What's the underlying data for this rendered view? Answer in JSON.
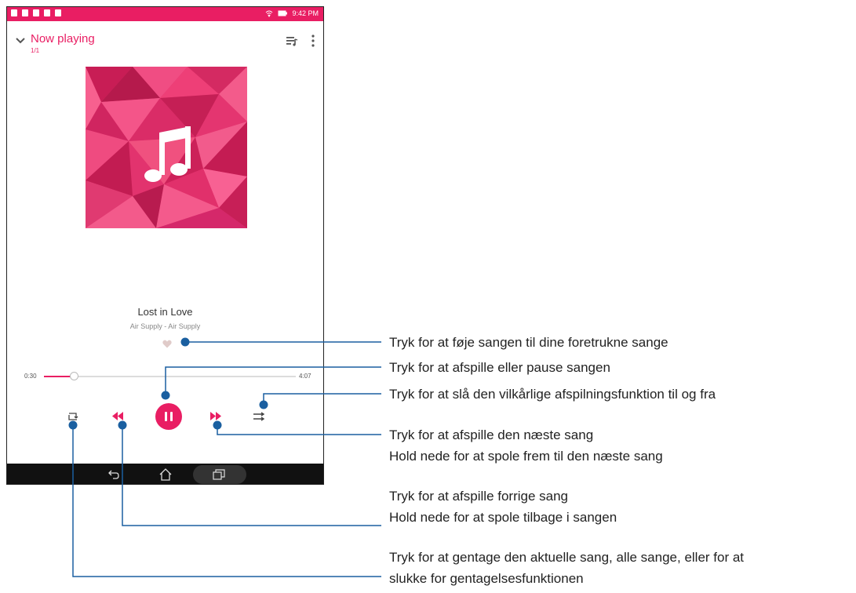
{
  "status_bar": {
    "time": "9:42 PM"
  },
  "header": {
    "title": "Now playing",
    "count": "1/1"
  },
  "track": {
    "title": "Lost in Love",
    "artist": "Air Supply - Air Supply"
  },
  "progress": {
    "elapsed": "0:30",
    "total": "4:07",
    "fraction": 0.12
  },
  "colors": {
    "accent": "#e91e63",
    "callout": "#1a5fa0",
    "nav_bar": "#111111"
  },
  "icons": [
    "chevron-down-icon",
    "queue-icon",
    "more-vert-icon",
    "music-note-icon",
    "heart-icon",
    "repeat-icon",
    "previous-icon",
    "pause-icon",
    "next-icon",
    "shuffle-icon",
    "back-icon",
    "home-icon",
    "recent-apps-icon"
  ],
  "annotations": {
    "favorite": [
      "Tryk for at føje sangen til dine foretrukne sange"
    ],
    "play_pause": [
      "Tryk for at afspille eller pause sangen"
    ],
    "shuffle": [
      "Tryk for at slå den vilkårlige afspilningsfunktion til og fra"
    ],
    "next": [
      "Tryk for at afspille den næste sang",
      "Hold nede for at spole frem til den næste sang"
    ],
    "previous": [
      "Tryk for at afspille forrige sang",
      "Hold nede for at spole tilbage i sangen"
    ],
    "repeat": [
      "Tryk for at gentage den aktuelle sang, alle sange, eller for at",
      "slukke for gentagelsesfunktionen"
    ]
  }
}
